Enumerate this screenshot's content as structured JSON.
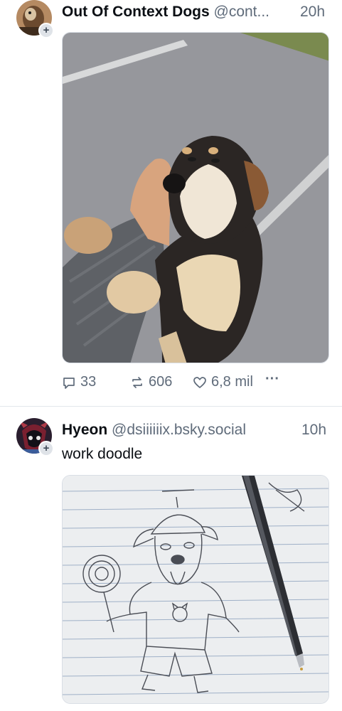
{
  "posts": [
    {
      "display_name": "Out Of Context Dogs",
      "handle": "@cont...",
      "time": "20h",
      "avatar_icon": "dog-avatar",
      "image_alt": "dog-being-petted-photo",
      "actions": {
        "replies": "33",
        "reposts": "606",
        "likes": "6,8 mil",
        "more": "···"
      }
    },
    {
      "display_name": "Hyeon",
      "handle": "@dsiiiiiix.bsky.social",
      "time": "10h",
      "avatar_icon": "drawn-character-avatar",
      "text": "work doodle",
      "image_alt": "pencil-dog-doodle-on-lined-paper"
    }
  ],
  "colors": {
    "muted": "#5f6b7a",
    "text": "#0b0f14",
    "divider": "#e3e7ec"
  }
}
